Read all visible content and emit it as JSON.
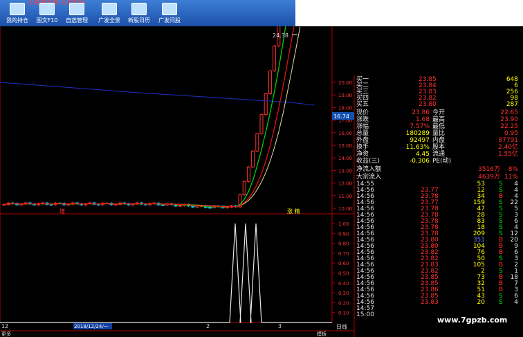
{
  "toolbar": {
    "title": "交易单登录  买卖助手",
    "buttons": [
      {
        "label": "我的持仓",
        "icon": "portfolio-icon"
      },
      {
        "label": "图文F10",
        "icon": "f10-icon"
      },
      {
        "label": "自选管理",
        "icon": "watchlist-icon"
      },
      {
        "label": "广发全景",
        "icon": "panorama-icon"
      },
      {
        "label": "新股日历",
        "icon": "calendar-icon"
      },
      {
        "label": "广发问股",
        "icon": "ask-icon"
      }
    ]
  },
  "chart_data": {
    "type": "line",
    "price_axis": {
      "ticks": [
        "20.00",
        "19.00",
        "18.00",
        "17.00",
        "16.00",
        "15.00",
        "14.00",
        "13.00",
        "12.00",
        "11.00",
        "10.00"
      ],
      "ylim": [
        9.0,
        21.2
      ]
    },
    "high_label": "24.38",
    "current_price": "16.74",
    "annotations": [
      "增",
      "涨 精"
    ],
    "indicator_axis": {
      "ticks": [
        "1.00",
        "0.90",
        "0.80",
        "0.70",
        "0.60",
        "0.50",
        "0.40",
        "0.30",
        "0.20",
        "0.10"
      ],
      "ylim": [
        0,
        1
      ]
    },
    "indicator_spikes": [
      340,
      355,
      370
    ],
    "x_labels": [
      "12",
      "2018/12/24/一",
      "2",
      "3"
    ],
    "date_label": "2018/12/24/一",
    "bottom_right_label": "日线",
    "status_left": "更多",
    "status_template": "模板"
  },
  "quote": {
    "asks": [
      {
        "label": "买一",
        "price": "23.85",
        "vol": "648"
      },
      {
        "label": "买二",
        "price": "23.84",
        "vol": "6"
      },
      {
        "label": "买三",
        "price": "23.83",
        "vol": "256"
      },
      {
        "label": "买四",
        "price": "23.82",
        "vol": "98"
      },
      {
        "label": "买五",
        "price": "23.80",
        "vol": "287"
      }
    ],
    "stats": [
      {
        "l1": "现价",
        "v1": "23.86",
        "l2": "今开",
        "v2": "22.65"
      },
      {
        "l1": "涨跌",
        "v1": "1.68",
        "l2": "最高",
        "v2": "23.90"
      },
      {
        "l1": "涨幅",
        "v1": "7.57%",
        "l2": "最低",
        "v2": "22.25"
      },
      {
        "l1": "总量",
        "v1": "180289",
        "l2": "量比",
        "v2": "0.95"
      },
      {
        "l1": "外盘",
        "v1": "92497",
        "l2": "内盘",
        "v2": "87791"
      },
      {
        "l1": "换手",
        "v1": "11.63%",
        "l2": "股本",
        "v2": "2.40亿"
      },
      {
        "l1": "净资",
        "v1": "4.45",
        "l2": "流通",
        "v2": "1.55亿"
      },
      {
        "l1": "收益(三)",
        "v1": "-0.306",
        "l2": "PE(动)",
        "v2": ""
      }
    ],
    "flow": [
      {
        "label": "净流入额",
        "value": "3516万",
        "pct": "8%"
      },
      {
        "label": "大宗流入",
        "value": "4639万",
        "pct": "11%"
      }
    ],
    "ticks": [
      {
        "t": "14:55",
        "p": "",
        "v": "53",
        "s": "S",
        "n": "4"
      },
      {
        "t": "14:56",
        "p": "23.77",
        "v": "12",
        "s": "S",
        "n": "4"
      },
      {
        "t": "14:56",
        "p": "23.78",
        "v": "34",
        "s": "B",
        "n": "4"
      },
      {
        "t": "14:56",
        "p": "23.77",
        "v": "159",
        "s": "S",
        "n": "22"
      },
      {
        "t": "14:56",
        "p": "23.78",
        "v": "47",
        "s": "S",
        "n": "5"
      },
      {
        "t": "14:56",
        "p": "23.78",
        "v": "28",
        "s": "S",
        "n": "3"
      },
      {
        "t": "14:56",
        "p": "23.78",
        "v": "83",
        "s": "S",
        "n": "6"
      },
      {
        "t": "14:56",
        "p": "23.78",
        "v": "18",
        "s": "S",
        "n": "4"
      },
      {
        "t": "14:56",
        "p": "23.78",
        "v": "209",
        "s": "S",
        "n": "12"
      },
      {
        "t": "14:56",
        "p": "23.80",
        "v": "351",
        "s": "B",
        "n": "20"
      },
      {
        "t": "14:56",
        "p": "23.80",
        "v": "104",
        "s": "B",
        "n": "9"
      },
      {
        "t": "14:56",
        "p": "23.82",
        "v": "76",
        "s": "B",
        "n": "6"
      },
      {
        "t": "14:56",
        "p": "23.82",
        "v": "50",
        "s": "S",
        "n": "3"
      },
      {
        "t": "14:56",
        "p": "23.83",
        "v": "105",
        "s": "B",
        "n": "2"
      },
      {
        "t": "14:56",
        "p": "23.82",
        "v": "2",
        "s": "S",
        "n": "1"
      },
      {
        "t": "14:56",
        "p": "23.85",
        "v": "73",
        "s": "B",
        "n": "18"
      },
      {
        "t": "14:56",
        "p": "23.85",
        "v": "32",
        "s": "B",
        "n": "7"
      },
      {
        "t": "14:56",
        "p": "23.86",
        "v": "51",
        "s": "B",
        "n": "3"
      },
      {
        "t": "14:56",
        "p": "23.85",
        "v": "43",
        "s": "S",
        "n": "6"
      },
      {
        "t": "14:56",
        "p": "23.83",
        "v": "20",
        "s": "S",
        "n": "4"
      },
      {
        "t": "14:57",
        "p": "",
        "v": "",
        "s": "",
        "n": ""
      },
      {
        "t": "15:00",
        "p": "",
        "v": "",
        "s": "",
        "n": ""
      }
    ]
  },
  "watermark": "www.7gpzb.com",
  "colors": {
    "up": "#ff3232",
    "down": "#00e000",
    "axis": "#b00000",
    "ma5": "#2030c8",
    "ma10": "#e0e0a0",
    "ma20": "#00d000",
    "ma30": "#e01010"
  }
}
